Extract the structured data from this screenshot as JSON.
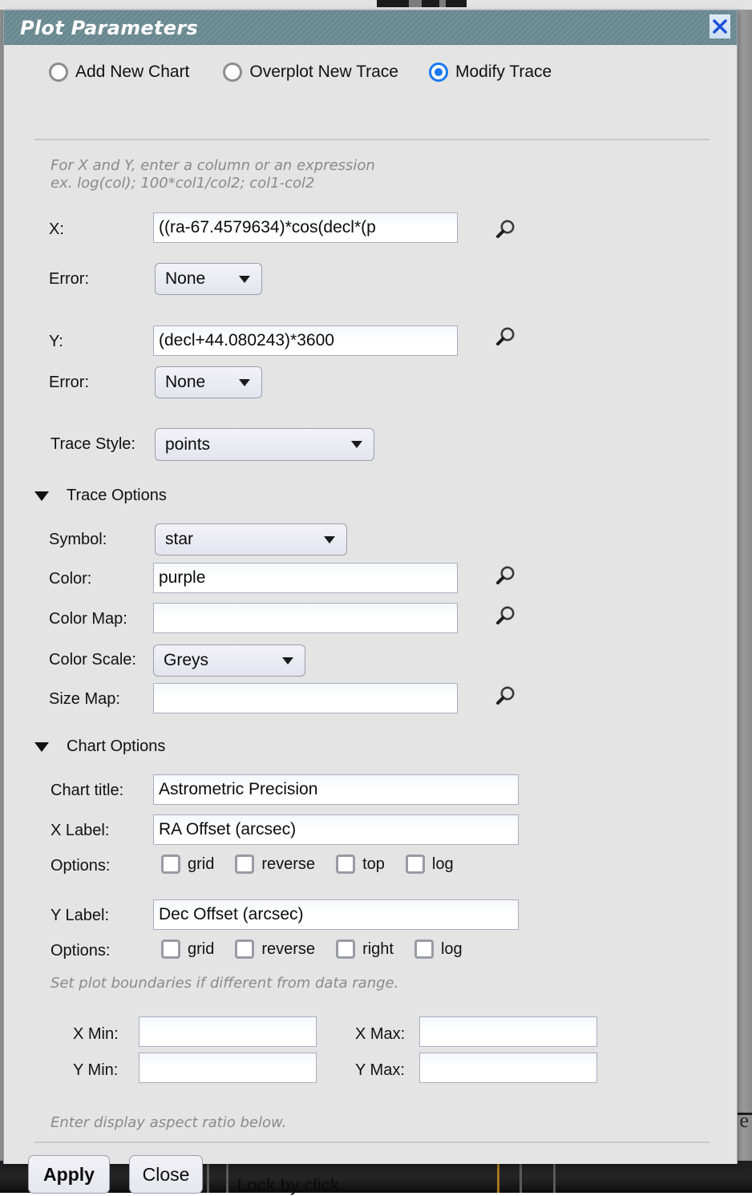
{
  "background": {
    "bottom_toolbar_label": "Lock by click",
    "right_edge_fragment": "e"
  },
  "window": {
    "title": "Plot Parameters",
    "close_icon": "close-x-icon",
    "titlebar_color": "#6d8c94",
    "accent_color": "#1878f0",
    "body_color": "#e4e4e4"
  },
  "mode": {
    "options": [
      {
        "label": "Add New Chart",
        "selected": false
      },
      {
        "label": "Overplot New Trace",
        "selected": false
      },
      {
        "label": "Modify Trace",
        "selected": true
      }
    ]
  },
  "hints": {
    "xy_hint_line1": "For X and Y, enter a column or an expression",
    "xy_hint_line2": "ex. log(col); 100*col1/col2; col1-col2",
    "bounds_hint": "Set plot boundaries if different from data range.",
    "aspect_hint": "Enter display aspect ratio below."
  },
  "axes": {
    "x_label": "X:",
    "x_value": "((ra-67.4579634)*cos(decl*(p",
    "x_error_label": "Error:",
    "x_error_value": "None",
    "y_label": "Y:",
    "y_value": "(decl+44.080243)*3600",
    "y_error_label": "Error:",
    "y_error_value": "None",
    "search_icon": "magnifier-icon"
  },
  "trace": {
    "style_label": "Trace Style:",
    "style_value": "points",
    "options_section": "Trace Options",
    "symbol_label": "Symbol:",
    "symbol_value": "star",
    "color_label": "Color:",
    "color_value": "purple",
    "color_map_label": "Color Map:",
    "color_map_value": "",
    "color_scale_label": "Color Scale:",
    "color_scale_value": "Greys",
    "size_map_label": "Size Map:",
    "size_map_value": ""
  },
  "chart": {
    "options_section": "Chart Options",
    "title_label": "Chart title:",
    "title_value": "Astrometric Precision",
    "x_label_label": "X Label:",
    "x_label_value": "RA Offset (arcsec)",
    "x_options_label": "Options:",
    "x_options": [
      {
        "label": "grid",
        "checked": false
      },
      {
        "label": "reverse",
        "checked": false
      },
      {
        "label": "top",
        "checked": false
      },
      {
        "label": "log",
        "checked": false
      }
    ],
    "y_label_label": "Y Label:",
    "y_label_value": "Dec Offset (arcsec)",
    "y_options_label": "Options:",
    "y_options": [
      {
        "label": "grid",
        "checked": false
      },
      {
        "label": "reverse",
        "checked": false
      },
      {
        "label": "right",
        "checked": false
      },
      {
        "label": "log",
        "checked": false
      }
    ]
  },
  "bounds": {
    "x_min_label": "X Min:",
    "x_min_value": "",
    "x_max_label": "X Max:",
    "x_max_value": "",
    "y_min_label": "Y Min:",
    "y_min_value": "",
    "y_max_label": "Y Max:",
    "y_max_value": ""
  },
  "footer": {
    "apply_label": "Apply",
    "close_label": "Close"
  }
}
